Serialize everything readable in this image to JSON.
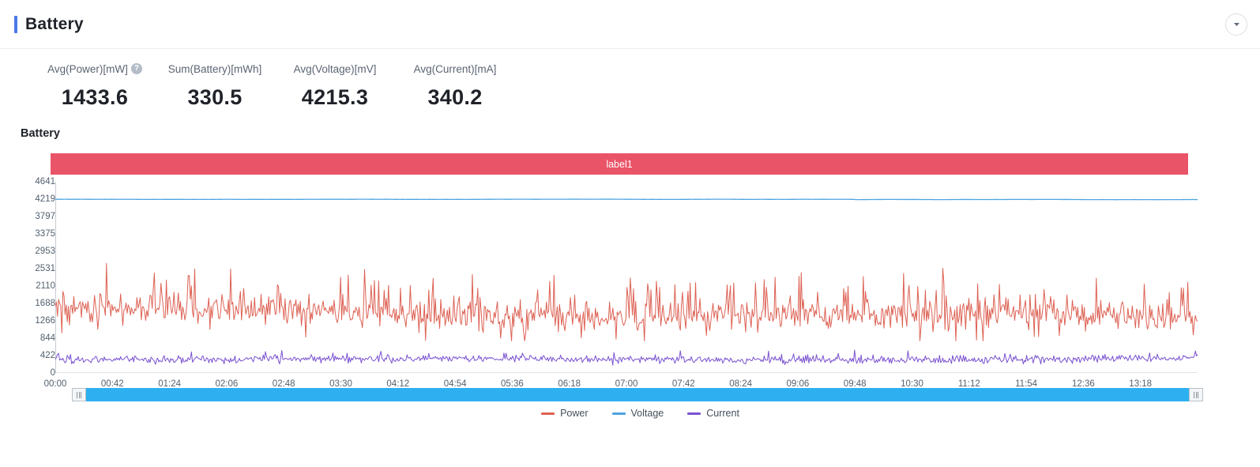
{
  "header": {
    "title": "Battery",
    "accent_color": "#4a79e8",
    "collapse_icon": "chevron-down-icon"
  },
  "kpis": [
    {
      "label": "Avg(Power)[mW]",
      "value": "1433.6",
      "help": "?",
      "has_help": true
    },
    {
      "label": "Sum(Battery)[mWh]",
      "value": "330.5",
      "has_help": false
    },
    {
      "label": "Avg(Voltage)[mV]",
      "value": "4215.3",
      "has_help": false
    },
    {
      "label": "Avg(Current)[mA]",
      "value": "340.2",
      "has_help": false
    }
  ],
  "chart_section": {
    "heading": "Battery",
    "label_band": {
      "text": "label1",
      "color": "#ea5468"
    }
  },
  "range_slider": {
    "start_percent": 0,
    "end_percent": 100,
    "track_color": "#2eb0f0"
  },
  "chart_data": {
    "type": "line",
    "title": "Battery",
    "xlabel": "",
    "ylabel": "",
    "grid": false,
    "legend_position": "bottom",
    "ylim": [
      0,
      4641
    ],
    "yticks": [
      0,
      422,
      844,
      1266,
      1688,
      2110,
      2531,
      2953,
      3375,
      3797,
      4219,
      4641
    ],
    "xticks": [
      "00:00",
      "00:42",
      "01:24",
      "02:06",
      "02:48",
      "03:30",
      "04:12",
      "04:54",
      "05:36",
      "06:18",
      "07:00",
      "07:42",
      "08:24",
      "09:06",
      "09:48",
      "10:30",
      "11:12",
      "11:54",
      "12:36",
      "13:18"
    ],
    "x_unit": "elapsed time (hh:mm)",
    "x_range": [
      "00:00",
      "13:40"
    ],
    "series": [
      {
        "name": "Power",
        "unit": "mW",
        "color": "#dd6153",
        "mean": 1433.6,
        "min": 780,
        "max": 2980,
        "noise_amplitude": 330,
        "spike_rate": 0.16,
        "spike_amplitude": 900,
        "seed": 7
      },
      {
        "name": "Voltage",
        "unit": "mV",
        "color": "#4ea3e0",
        "mean": 4215.3,
        "min": 4208,
        "max": 4224,
        "noise_amplitude": 3,
        "spike_rate": 0,
        "spike_amplitude": 0,
        "seed": 3,
        "step_at": 0.7,
        "step_delta": -6
      },
      {
        "name": "Current",
        "unit": "mA",
        "color": "#7a52d0",
        "mean": 340.2,
        "min": 150,
        "max": 620,
        "noise_amplitude": 85,
        "spike_rate": 0.1,
        "spike_amplitude": 170,
        "seed": 11
      }
    ]
  },
  "legend": [
    {
      "label": "Power",
      "color": "#dd6153"
    },
    {
      "label": "Voltage",
      "color": "#4ea3e0"
    },
    {
      "label": "Current",
      "color": "#7a52d0"
    }
  ]
}
